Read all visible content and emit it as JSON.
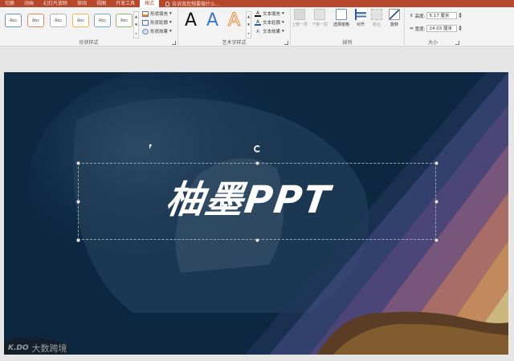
{
  "tabs": [
    {
      "label": "切换",
      "active": false
    },
    {
      "label": "动画",
      "active": false
    },
    {
      "label": "幻灯片放映",
      "active": false
    },
    {
      "label": "审阅",
      "active": false
    },
    {
      "label": "视图",
      "active": false
    },
    {
      "label": "开发工具",
      "active": false
    },
    {
      "label": "格式",
      "active": true
    }
  ],
  "tell_me": {
    "placeholder": "告诉我您想要做什么...",
    "icon": "lightbulb-icon"
  },
  "shape_styles": {
    "group_label": "形状样式",
    "swatches": [
      "Abc",
      "Abc",
      "Abc",
      "Abc",
      "Abc",
      "Abc"
    ],
    "commands": {
      "fill": "形状填充",
      "outline": "形状轮廓",
      "effects": "形状效果"
    }
  },
  "wordart_styles": {
    "group_label": "艺术字样式",
    "letters": [
      "A",
      "A",
      "A"
    ],
    "commands": {
      "fill": "文本填充",
      "outline": "文本轮廓",
      "effects": "文本效果"
    }
  },
  "arrange": {
    "group_label": "排列",
    "buttons": {
      "bring_forward": "上移一层",
      "send_backward": "下移一层",
      "selection_pane": "选择窗格",
      "align": "对齐",
      "group": "组合",
      "rotate": "旋转"
    }
  },
  "size": {
    "group_label": "大小",
    "height_label": "高度:",
    "height_value": "5.17 厘米",
    "width_label": "宽度:",
    "width_value": "24.03 厘米"
  },
  "slide": {
    "title": "柚墨PPT"
  },
  "watermark": {
    "logo": "K.DO",
    "text": "大数跨境"
  },
  "colors": {
    "accent": "#b7472a",
    "slide_bg": "#0d2741"
  }
}
